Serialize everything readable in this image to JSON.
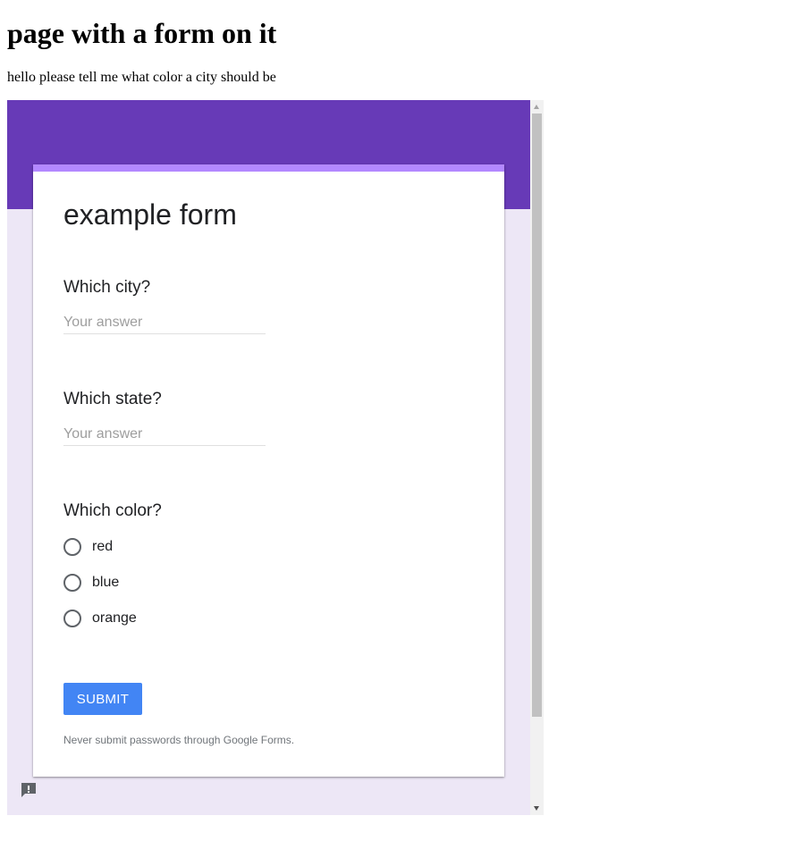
{
  "page": {
    "title": "page with a form on it",
    "intro": "hello please tell me what color a city should be"
  },
  "form": {
    "title": "example form",
    "questions": [
      {
        "label": "Which city?",
        "placeholder": "Your answer"
      },
      {
        "label": "Which state?",
        "placeholder": "Your answer"
      },
      {
        "label": "Which color?",
        "options": [
          "red",
          "blue",
          "orange"
        ]
      }
    ],
    "submit_label": "SUBMIT",
    "disclaimer": "Never submit passwords through Google Forms.",
    "report_icon": "report-issue-icon"
  },
  "colors": {
    "header": "#673ab7",
    "accent": "#b388ff",
    "background": "#ede7f6",
    "submit": "#4285f4"
  }
}
